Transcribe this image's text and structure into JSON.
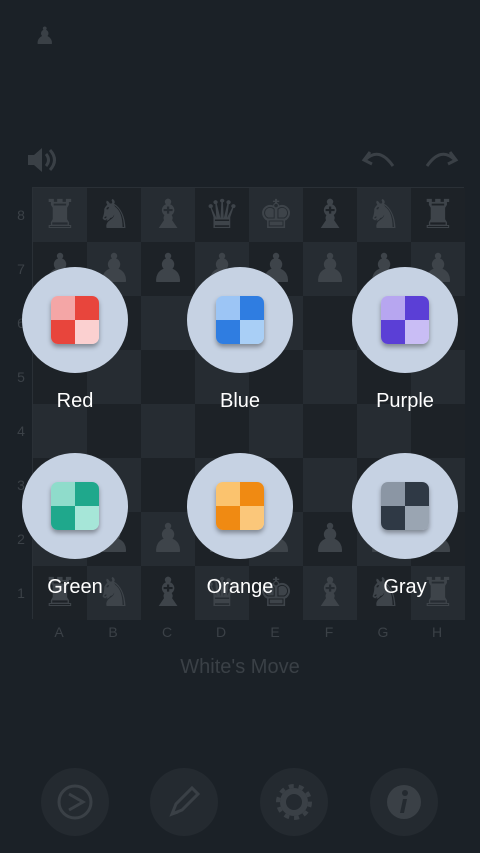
{
  "app": {
    "logo_icon": "pawn-icon"
  },
  "toolbar": {
    "sound_icon": "speaker-icon",
    "undo_icon": "undo-icon",
    "redo_icon": "redo-icon"
  },
  "board": {
    "ranks": [
      "8",
      "7",
      "6",
      "5",
      "4",
      "3",
      "2",
      "1"
    ],
    "files": [
      "A",
      "B",
      "C",
      "D",
      "E",
      "F",
      "G",
      "H"
    ],
    "pieces": [
      [
        "♜",
        "♞",
        "♝",
        "♛",
        "♚",
        "♝",
        "♞",
        "♜"
      ],
      [
        "♟",
        "♟",
        "♟",
        "♟",
        "♟",
        "♟",
        "♟",
        "♟"
      ],
      [
        "",
        "",
        "",
        "",
        "",
        "",
        "",
        ""
      ],
      [
        "",
        "",
        "",
        "",
        "",
        "",
        "",
        ""
      ],
      [
        "",
        "",
        "",
        "",
        "",
        "",
        "",
        ""
      ],
      [
        "",
        "",
        "",
        "",
        "",
        "",
        "",
        ""
      ],
      [
        "♟",
        "♟",
        "♟",
        "♟",
        "♟",
        "♟",
        "♟",
        "♟"
      ],
      [
        "♜",
        "♞",
        "♝",
        "♛",
        "♚",
        "♝",
        "♞",
        "♜"
      ]
    ]
  },
  "status": {
    "turn": "White's Move"
  },
  "controls": {
    "icons": [
      "play-icon",
      "pencil-icon",
      "gear-icon",
      "info-icon"
    ]
  },
  "color_picker": {
    "options": [
      {
        "label": "Red",
        "colors": [
          "#f4a6a6",
          "#e8453c",
          "#e8453c",
          "#fbd0d0"
        ]
      },
      {
        "label": "Blue",
        "colors": [
          "#9cc5f5",
          "#2f7de1",
          "#2f7de1",
          "#a9cff6"
        ]
      },
      {
        "label": "Purple",
        "colors": [
          "#b7a6f0",
          "#5b3fd6",
          "#5b3fd6",
          "#c9bdf5"
        ]
      },
      {
        "label": "Green",
        "colors": [
          "#8fdccb",
          "#1fa88c",
          "#1fa88c",
          "#a6e6d8"
        ]
      },
      {
        "label": "Orange",
        "colors": [
          "#fbc36e",
          "#f08a12",
          "#f08a12",
          "#fbc77a"
        ]
      },
      {
        "label": "Gray",
        "colors": [
          "#8b96a4",
          "#2f3945",
          "#2f3945",
          "#9aa5b2"
        ]
      }
    ]
  }
}
